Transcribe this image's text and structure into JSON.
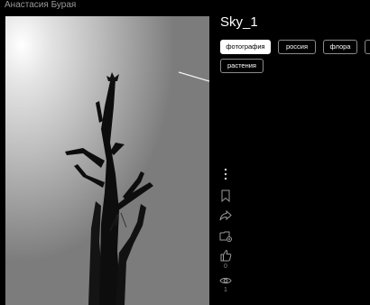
{
  "author": {
    "name": "Анастасия Бурая"
  },
  "photo": {
    "title": "Sky_1"
  },
  "tags": [
    {
      "label": "фотография",
      "active": true
    },
    {
      "label": "россия",
      "active": false
    },
    {
      "label": "флора",
      "active": false
    },
    {
      "label": "растения",
      "active": false
    }
  ],
  "actions": {
    "more_icon": "more-vertical-icon",
    "bookmark_icon": "bookmark-icon",
    "share_icon": "share-icon",
    "add_collection_icon": "add-to-collection-icon",
    "like_icon": "like-icon",
    "likes_count": "0",
    "views_icon": "eye-icon",
    "views_count": "1"
  }
}
